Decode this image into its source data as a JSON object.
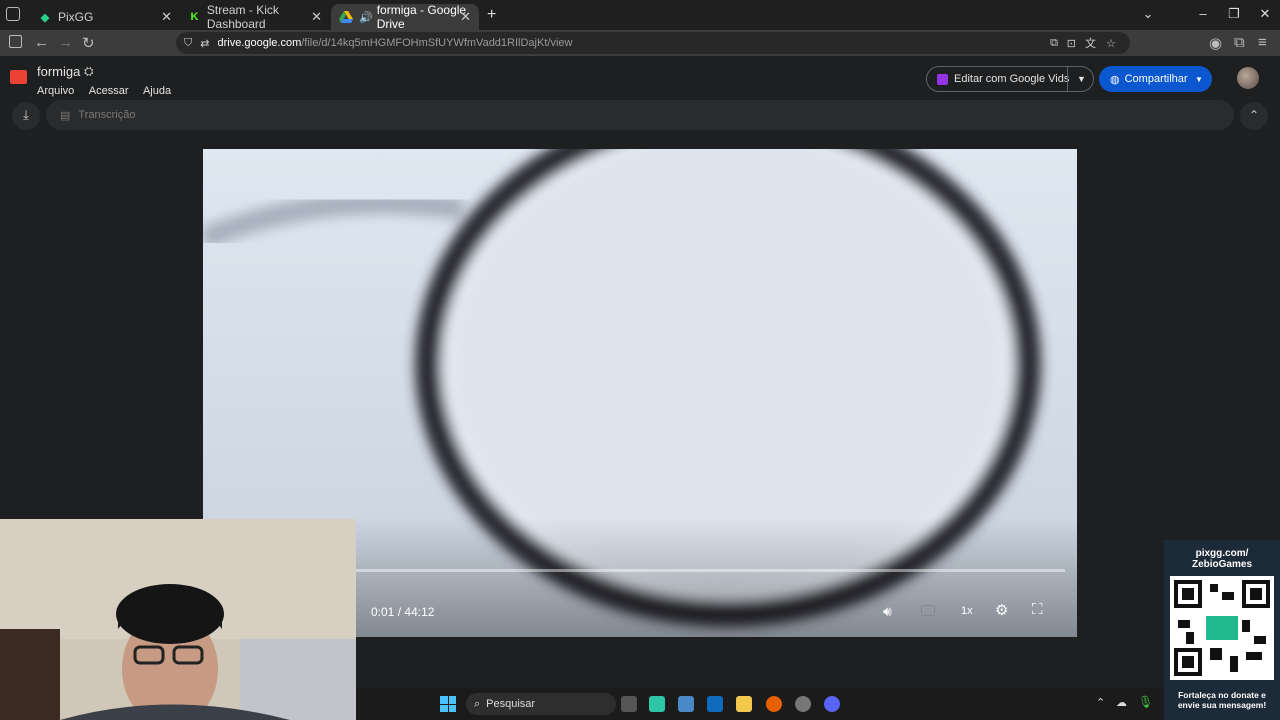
{
  "browser": {
    "tabs": [
      {
        "title": "PixGG",
        "active": false
      },
      {
        "title": "Stream - Kick Dashboard",
        "active": false
      },
      {
        "title": "formiga - Google Drive",
        "active": true
      }
    ],
    "url_host": "drive.google.com",
    "url_path": "/file/d/14kq5mHGMFOHmSfUYWfmVadd1RIlDajKt/view"
  },
  "drive": {
    "file_name": "formiga",
    "menu": [
      "Arquivo",
      "Acessar",
      "Ajuda"
    ],
    "edit_button": "Editar com Google Vids",
    "share_button": "Compartilhar",
    "transcript_label": "Transcrição"
  },
  "player": {
    "current_time": "0:01",
    "separator": "/",
    "duration": "44:12",
    "progress_fraction": 0.0004,
    "speed": "1x"
  },
  "taskbar": {
    "search_placeholder": "Pesquisar"
  },
  "overlay": {
    "pix_line1": "pixgg.com/",
    "pix_line2": "ZebioGames",
    "donate_line1": "Fortaleça no donate e",
    "donate_line2": "envie sua mensagem!"
  },
  "colors": {
    "accent": "#0b57d0",
    "share_bg": "#0b57d0",
    "kick_green": "#53fc18"
  }
}
